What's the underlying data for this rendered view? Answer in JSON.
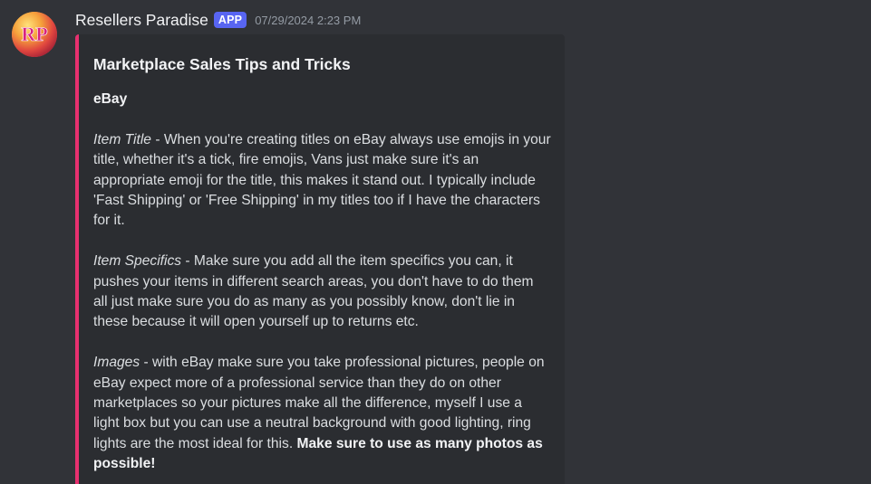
{
  "message": {
    "author": "Resellers Paradise",
    "badge": "APP",
    "timestamp": "07/29/2024 2:23 PM",
    "avatar_letters": "RP"
  },
  "embed": {
    "accent_color": "#e7306f",
    "title": "Marketplace Sales Tips and Tricks",
    "section_heading": "eBay",
    "paragraphs": [
      {
        "label": "Item Title",
        "separator": " - ",
        "text": "When you're creating titles on eBay always use emojis in your title, whether it's a tick, fire emojis, Vans just make sure it's an appropriate emoji for the title, this makes it stand out. I typically include 'Fast Shipping' or 'Free Shipping' in my titles too if I have the characters for it."
      },
      {
        "label": "Item Specifics",
        "separator": " - ",
        "text": "Make sure you add all the item specifics you can, it pushes your items in different search areas, you don't have to do them all just make sure you do as many as you possibly know, don't lie in these because it will open yourself up to returns etc."
      },
      {
        "label": "Images",
        "separator": " - ",
        "text": "with eBay make sure you take professional pictures, people on eBay expect more of a professional service than they do on other marketplaces so your pictures make all the difference, myself I use a light box but you can use a neutral background with good lighting, ring lights are the most ideal for this. ",
        "bold": "Make sure to use as many photos as possible!"
      }
    ]
  }
}
